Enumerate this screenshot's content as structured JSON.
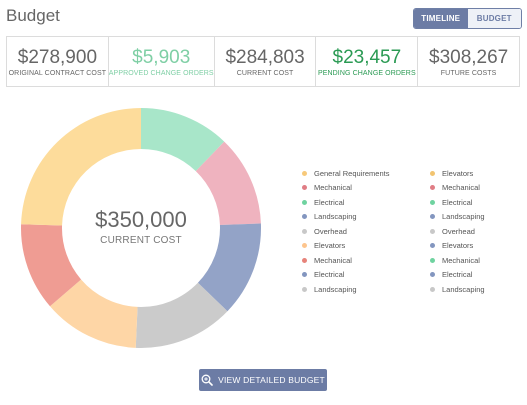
{
  "header": {
    "title": "Budget",
    "toggle": [
      {
        "label": "TIMELINE",
        "active": true
      },
      {
        "label": "BUDGET",
        "active": false
      }
    ]
  },
  "stats": [
    {
      "value": "$278,900",
      "label": "ORIGINAL CONTRACT COST",
      "color": "#666666"
    },
    {
      "value": "$5,903",
      "label": "APPROVED CHANGE ORDERS",
      "color": "#7fcfa5"
    },
    {
      "value": "$284,803",
      "label": "CURRENT COST",
      "color": "#666666"
    },
    {
      "value": "$23,457",
      "label": "PENDING CHANGE ORDERS",
      "color": "#2a9a53"
    },
    {
      "value": "$308,267",
      "label": "FUTURE COSTS",
      "color": "#666666"
    }
  ],
  "donut": {
    "center_value": "$350,000",
    "center_label": "CURRENT COST",
    "segments": [
      {
        "name": "green",
        "value": 12.2,
        "color": "#a8e6c9"
      },
      {
        "name": "pink",
        "value": 12.2,
        "color": "#efb3bf"
      },
      {
        "name": "blue",
        "value": 12.8,
        "color": "#93a3c7"
      },
      {
        "name": "gray",
        "value": 13.5,
        "color": "#cbcbcb"
      },
      {
        "name": "peach",
        "value": 13.0,
        "color": "#fed6a6"
      },
      {
        "name": "salmon",
        "value": 11.8,
        "color": "#ef9c93"
      },
      {
        "name": "yellow",
        "value": 24.5,
        "color": "#fddc9b"
      }
    ]
  },
  "legend": [
    {
      "label": "General Requirements",
      "color": "#f7c97a"
    },
    {
      "label": "Elevators",
      "color": "#f2c470"
    },
    {
      "label": "Mechanical",
      "color": "#e07d85"
    },
    {
      "label": "Mechanical",
      "color": "#e07d85"
    },
    {
      "label": "Electrical",
      "color": "#6fd3a0"
    },
    {
      "label": "Electrical",
      "color": "#6fd3a0"
    },
    {
      "label": "Landscaping",
      "color": "#8396bf"
    },
    {
      "label": "Landscaping",
      "color": "#8396bf"
    },
    {
      "label": "Overhead",
      "color": "#c8c8c8"
    },
    {
      "label": "Overhead",
      "color": "#c8c8c8"
    },
    {
      "label": "Elevators",
      "color": "#fdc58e"
    },
    {
      "label": "Elevators",
      "color": "#8396bf"
    },
    {
      "label": "Mechanical",
      "color": "#e7837a"
    },
    {
      "label": "Mechanical",
      "color": "#6fd3a0"
    },
    {
      "label": "Electrical",
      "color": "#8396bf"
    },
    {
      "label": "Electrical",
      "color": "#8396bf"
    },
    {
      "label": "Landscaping",
      "color": "#c8c8c8"
    },
    {
      "label": "Landscaping",
      "color": "#c8c8c8"
    }
  ],
  "actions": {
    "view_detailed_budget": "VIEW DETAILED BUDGET"
  }
}
